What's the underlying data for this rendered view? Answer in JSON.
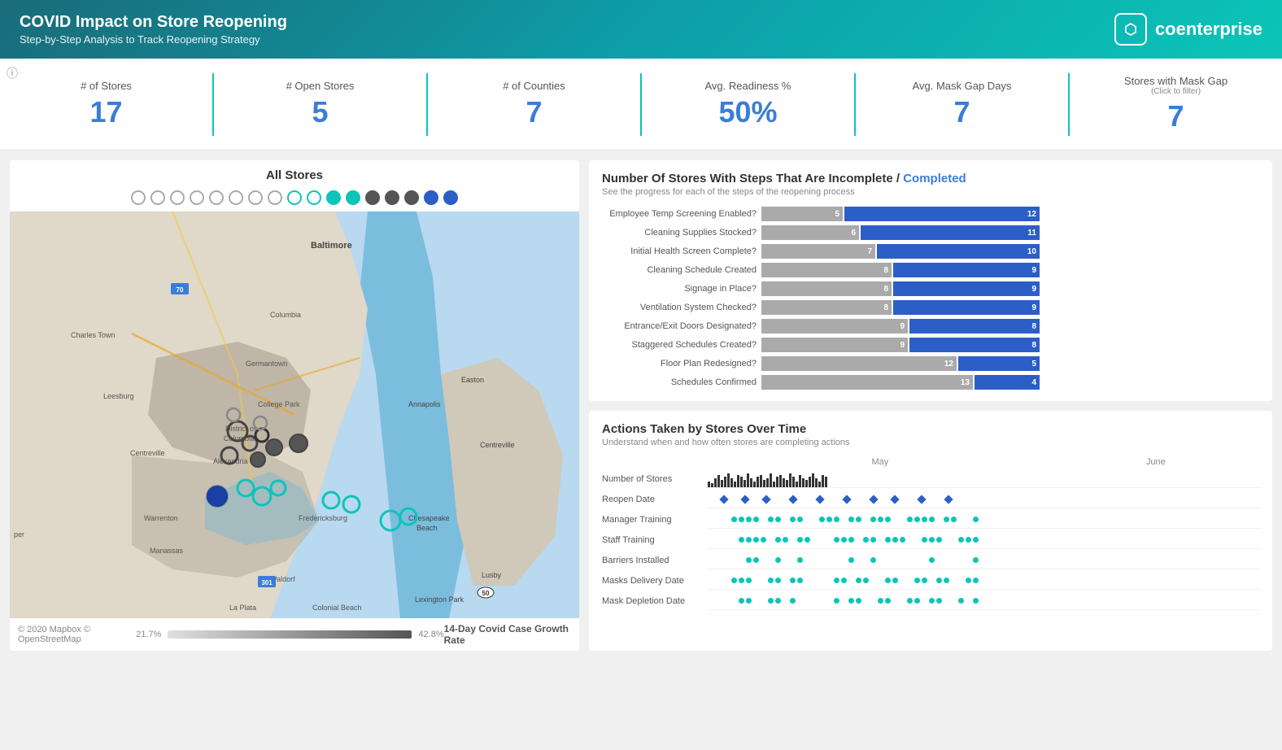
{
  "header": {
    "title": "COVID Impact on Store Reopening",
    "subtitle": "Step-by-Step Analysis to Track Reopening Strategy",
    "logo_text": "coenterprise"
  },
  "kpi": {
    "stores_label": "# of Stores",
    "stores_value": "17",
    "open_stores_label": "# Open Stores",
    "open_stores_value": "5",
    "counties_label": "# of Counties",
    "counties_value": "7",
    "readiness_label": "Avg. Readiness %",
    "readiness_value": "50%",
    "mask_gap_label": "Avg. Mask Gap Days",
    "mask_gap_value": "7",
    "mask_gap_filter_label": "Stores with Mask Gap",
    "mask_gap_filter_note": "(Click to filter)",
    "mask_gap_filter_value": "7"
  },
  "map": {
    "title": "All Stores",
    "footer_source": "© 2020 Mapbox © OpenStreetMap",
    "legend_title": "14-Day Covid Case Growth Rate",
    "legend_min": "21.7%",
    "legend_max": "42.8%"
  },
  "steps_chart": {
    "title_part1": "Number Of Stores With Steps That Are ",
    "incomplete_label": "Incomplete",
    "separator": " / ",
    "completed_label": "Completed",
    "subtitle": "See the progress for each of the steps of the reopening process",
    "bars": [
      {
        "label": "Employee Temp Screening Enabled?",
        "incomplete": 5,
        "completed": 12,
        "incomplete_pct": 29,
        "completed_pct": 71
      },
      {
        "label": "Cleaning Supplies Stocked?",
        "incomplete": 6,
        "completed": 11,
        "incomplete_pct": 35,
        "completed_pct": 65
      },
      {
        "label": "Initial Health Screen Complete?",
        "incomplete": 7,
        "completed": 10,
        "incomplete_pct": 41,
        "completed_pct": 59
      },
      {
        "label": "Cleaning Schedule Created",
        "incomplete": 8,
        "completed": 9,
        "incomplete_pct": 47,
        "completed_pct": 53
      },
      {
        "label": "Signage in Place?",
        "incomplete": 8,
        "completed": 9,
        "incomplete_pct": 47,
        "completed_pct": 53
      },
      {
        "label": "Ventilation System Checked?",
        "incomplete": 8,
        "completed": 9,
        "incomplete_pct": 47,
        "completed_pct": 53
      },
      {
        "label": "Entrance/Exit Doors Designated?",
        "incomplete": 9,
        "completed": 8,
        "incomplete_pct": 53,
        "completed_pct": 47
      },
      {
        "label": "Staggered Schedules Created?",
        "incomplete": 9,
        "completed": 8,
        "incomplete_pct": 53,
        "completed_pct": 47
      },
      {
        "label": "Floor Plan Redesigned?",
        "incomplete": 12,
        "completed": 5,
        "incomplete_pct": 71,
        "completed_pct": 29
      },
      {
        "label": "Schedules Confirmed",
        "incomplete": 13,
        "completed": 4,
        "incomplete_pct": 76,
        "completed_pct": 24
      }
    ]
  },
  "timeline": {
    "title": "Actions Taken by Stores Over Time",
    "subtitle": "Understand when and how often stores are completing actions",
    "col_may": "May",
    "col_june": "June",
    "rows": [
      {
        "label": "Number of Stores",
        "type": "bars"
      },
      {
        "label": "Reopen Date",
        "type": "diamonds"
      },
      {
        "label": "Manager Training",
        "type": "dots_teal"
      },
      {
        "label": "Staff Training",
        "type": "dots_teal"
      },
      {
        "label": "Barriers Installed",
        "type": "dots_teal"
      },
      {
        "label": "Masks Delivery Date",
        "type": "dots_teal"
      },
      {
        "label": "Mask Depletion Date",
        "type": "dots_teal"
      }
    ]
  }
}
